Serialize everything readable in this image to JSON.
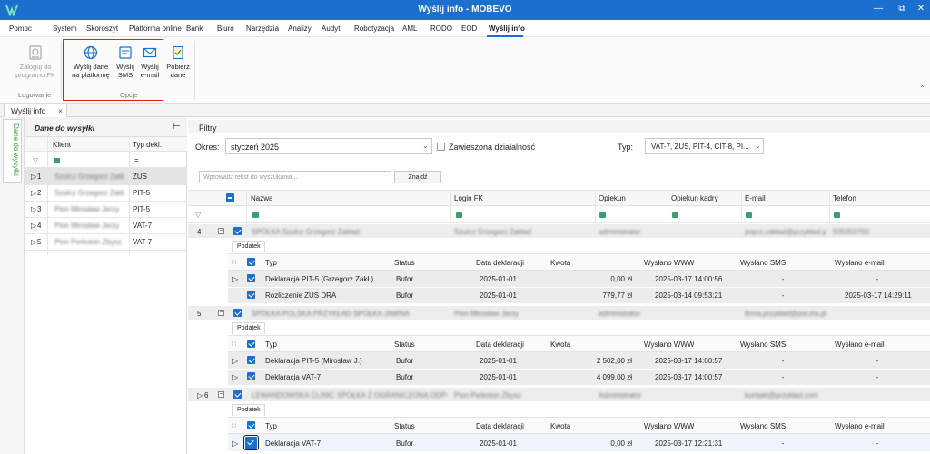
{
  "window": {
    "title": "Wyślij info - MOBEVO",
    "buttons": {
      "minimize": "—",
      "restore": "⧉",
      "close": "✕"
    }
  },
  "menu": [
    "Pomoc",
    "System",
    "Skoroszyt",
    "Platforma online",
    "Bank",
    "Biuro",
    "Narzędzia",
    "Analizy",
    "Audyt",
    "Robotyzacja",
    "AML",
    "RODO",
    "EOD",
    "Wyślij info"
  ],
  "ribbon": {
    "login_group": {
      "button": [
        "Zaloguj do",
        "programu FK"
      ],
      "label": "Logowanie"
    },
    "options_group": {
      "buttons": [
        {
          "line1": "Wyślij dane",
          "line2": "na platformę"
        },
        {
          "line1": "Wyślij",
          "line2": "SMS"
        },
        {
          "line1": "Wyślij",
          "line2": "e-mail"
        }
      ],
      "label": "Opcje"
    },
    "download": {
      "line1": "Pobierz",
      "line2": "dane"
    }
  },
  "doc_tab": {
    "label": "Wyślij info",
    "close": "×"
  },
  "side_tab": {
    "label": "Dane do wysyłki"
  },
  "left_panel": {
    "title": "Dane do wysyłki",
    "pin": "⊢",
    "columns": [
      "Klient",
      "Typ dekl."
    ],
    "filter_eq": "=",
    "rows": [
      {
        "num": "1",
        "client": "Szulcz Grzegorz Zakł.",
        "type": "ZUS"
      },
      {
        "num": "2",
        "client": "Szulcz Grzegorz Zakł.",
        "type": "PIT-5"
      },
      {
        "num": "3",
        "client": "Pion Mirosław Jerzy",
        "type": "PIT-5"
      },
      {
        "num": "4",
        "client": "Pion Mirosław Jerzy",
        "type": "VAT-7"
      },
      {
        "num": "5",
        "client": "Pion Perkoton Zbysz",
        "type": "VAT-7"
      }
    ]
  },
  "filters": {
    "title": "Filtry",
    "period_label": "Okres:",
    "period_value": "styczeń 2025",
    "suspended_label": "Zawieszona działalność",
    "type_label": "Typ:",
    "type_value": "VAT-7, ZUS, PIT-4, CIT-8, PI...",
    "search_placeholder": "Wprowadź tekst do wyszukania...",
    "search_button": "Znajdź"
  },
  "grid": {
    "columns": [
      "Nazwa",
      "Login FK",
      "Opiekun",
      "Opiekun kadry",
      "E-mail",
      "Telefon"
    ],
    "subcolumns": [
      "Typ",
      "Status",
      "Data deklaracji",
      "Kwota",
      "Wysłano WWW",
      "Wysłano SMS",
      "Wysłano e-mail"
    ],
    "subtab_label": "Podatek",
    "groups": [
      {
        "num": "4",
        "name": "SPÓŁKA Szulcz Grzegorz Zakład",
        "login": "Szulcz Grzegorz Zakład",
        "guardian": "administrator",
        "email": "poprz.zakład@przykład.pl",
        "phone": "505050700",
        "rows": [
          {
            "type": "Deklaracja PIT-5 (Grzegorz Zakł.)",
            "status": "Bufor",
            "date": "2025-01-01",
            "amount": "0,00 zł",
            "www": "2025-03-17 14:00:56",
            "sms": "-",
            "email": "-"
          },
          {
            "type": "Rozliczenie ZUS DRA",
            "status": "Bufor",
            "date": "2025-01-01",
            "amount": "779,77 zł",
            "www": "2025-03-14 09:53:21",
            "sms": "-",
            "email": "2025-03-17 14:29:11"
          }
        ]
      },
      {
        "num": "5",
        "name": "SPÓŁKA POLSKA PRZYKŁAD SPÓŁKA JAWNA",
        "login": "Pion Mirosław Jerzy",
        "guardian": "administrator",
        "email": "firma.przykład@poczta.pl",
        "phone": "",
        "rows": [
          {
            "type": "Deklaracja PIT-5 (Mirosław J.)",
            "status": "Bufor",
            "date": "2025-01-01",
            "amount": "2 502,00 zł",
            "www": "2025-03-17 14:00:57",
            "sms": "-",
            "email": "-"
          },
          {
            "type": "Deklaracja VAT-7",
            "status": "Bufor",
            "date": "2025-01-01",
            "amount": "4 099,00 zł",
            "www": "2025-03-17 14:00:57",
            "sms": "-",
            "email": "-"
          }
        ]
      },
      {
        "num": "6",
        "name": "LEWANDOWSKA CLINIC SPÓŁKA Z OGRANICZONĄ ODPOWIEDZ",
        "login": "Pion Perkoton Zbysz",
        "guardian": "Administrator",
        "email": "kontakt@przykład.com",
        "phone": "",
        "rows": [
          {
            "type": "Deklaracja VAT-7",
            "status": "Bufor",
            "date": "2025-01-01",
            "amount": "0,00 zł",
            "www": "2025-03-17 12:21:31",
            "sms": "-",
            "email": "-"
          }
        ]
      }
    ]
  },
  "colors": {
    "accent": "#1a6fcf",
    "highlight": "#e02020",
    "side_tab_text": "#3a9a3a"
  }
}
